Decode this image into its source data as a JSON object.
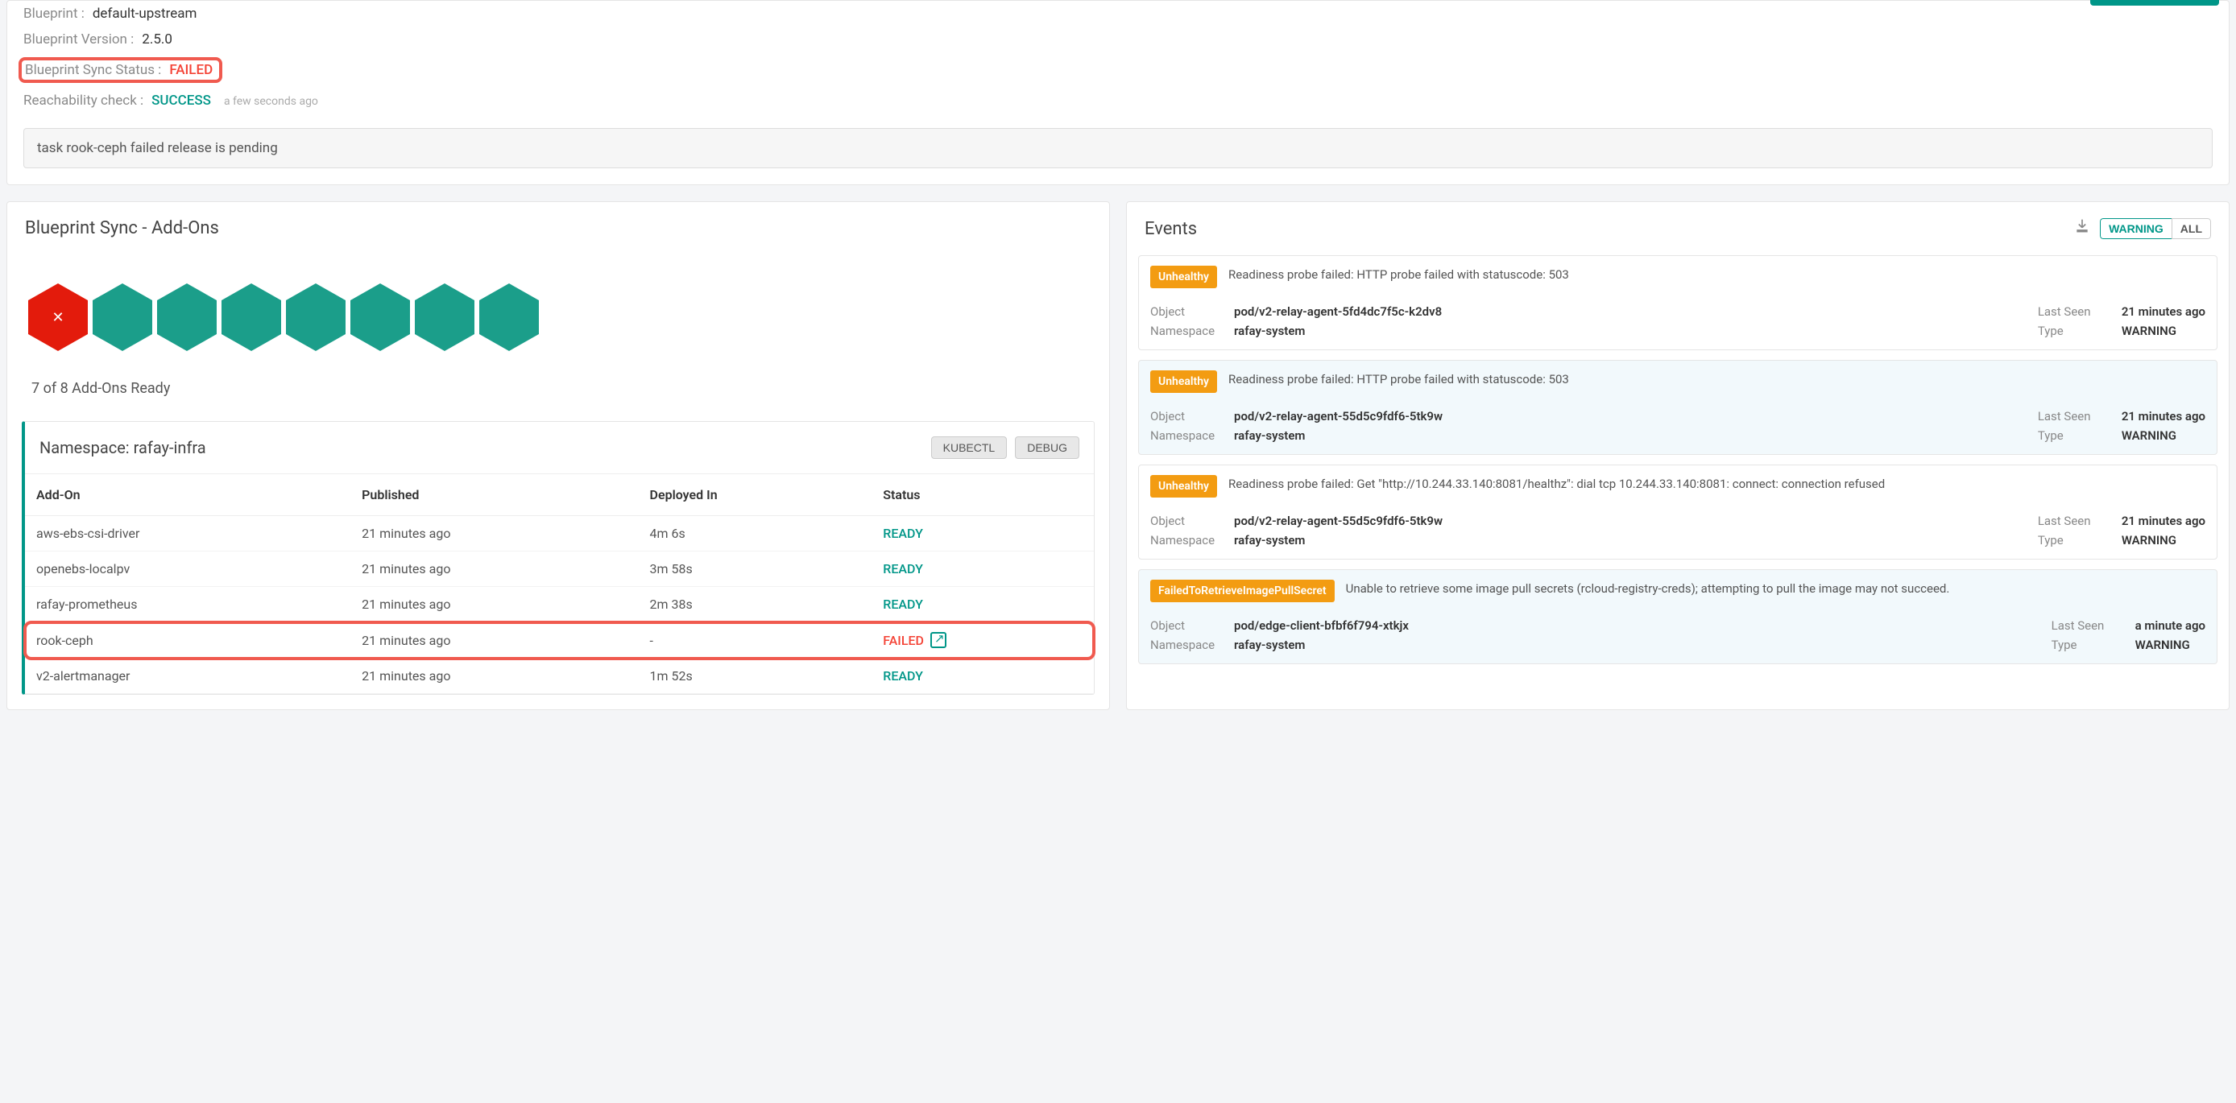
{
  "blueprint": {
    "label": "Blueprint :",
    "value": "default-upstream"
  },
  "blueprintVersion": {
    "label": "Blueprint Version :",
    "value": "2.5.0"
  },
  "syncStatus": {
    "label": "Blueprint Sync Status :",
    "value": "FAILED"
  },
  "reachability": {
    "label": "Reachability check :",
    "value": "SUCCESS",
    "ago": "a few seconds ago"
  },
  "taskMessage": "task rook-ceph failed release is pending",
  "addonsPanel": {
    "title": "Blueprint Sync - Add-Ons",
    "summary": "7 of 8 Add-Ons Ready",
    "hexStates": [
      "failed",
      "ok",
      "ok",
      "ok",
      "ok",
      "ok",
      "ok",
      "ok"
    ],
    "namespaceTitle": "Namespace: rafay-infra",
    "kubectlBtn": "KUBECTL",
    "debugBtn": "DEBUG",
    "columns": {
      "addon": "Add-On",
      "published": "Published",
      "deployed": "Deployed In",
      "status": "Status"
    },
    "rows": [
      {
        "name": "aws-ebs-csi-driver",
        "published": "21 minutes ago",
        "deployed": "4m 6s",
        "status": "READY",
        "hl": false
      },
      {
        "name": "openebs-localpv",
        "published": "21 minutes ago",
        "deployed": "3m 58s",
        "status": "READY",
        "hl": false
      },
      {
        "name": "rafay-prometheus",
        "published": "21 minutes ago",
        "deployed": "2m 38s",
        "status": "READY",
        "hl": false
      },
      {
        "name": "rook-ceph",
        "published": "21 minutes ago",
        "deployed": "-",
        "status": "FAILED",
        "hl": true
      },
      {
        "name": "v2-alertmanager",
        "published": "21 minutes ago",
        "deployed": "1m 52s",
        "status": "READY",
        "hl": false
      }
    ]
  },
  "eventsPanel": {
    "title": "Events",
    "filterWarning": "WARNING",
    "filterAll": "ALL",
    "events": [
      {
        "badge": "Unhealthy",
        "msg": "Readiness probe failed: HTTP probe failed with statuscode: 503",
        "object": "pod/v2-relay-agent-5fd4dc7f5c-k2dv8",
        "namespace": "rafay-system",
        "lastSeen": "21 minutes ago",
        "type": "WARNING",
        "alt": false
      },
      {
        "badge": "Unhealthy",
        "msg": "Readiness probe failed: HTTP probe failed with statuscode: 503",
        "object": "pod/v2-relay-agent-55d5c9fdf6-5tk9w",
        "namespace": "rafay-system",
        "lastSeen": "21 minutes ago",
        "type": "WARNING",
        "alt": true
      },
      {
        "badge": "Unhealthy",
        "msg": "Readiness probe failed: Get \"http://10.244.33.140:8081/healthz\": dial tcp 10.244.33.140:8081: connect: connection refused",
        "object": "pod/v2-relay-agent-55d5c9fdf6-5tk9w",
        "namespace": "rafay-system",
        "lastSeen": "21 minutes ago",
        "type": "WARNING",
        "alt": false
      },
      {
        "badge": "FailedToRetrieveImagePullSecret",
        "msg": "Unable to retrieve some image pull secrets (rcloud-registry-creds); attempting to pull the image may not succeed.",
        "object": "pod/edge-client-bfbf6f794-xtkjx",
        "namespace": "rafay-system",
        "lastSeen": "a minute ago",
        "type": "WARNING",
        "alt": true
      }
    ],
    "labels": {
      "object": "Object",
      "namespace": "Namespace",
      "lastSeen": "Last Seen",
      "type": "Type"
    }
  }
}
